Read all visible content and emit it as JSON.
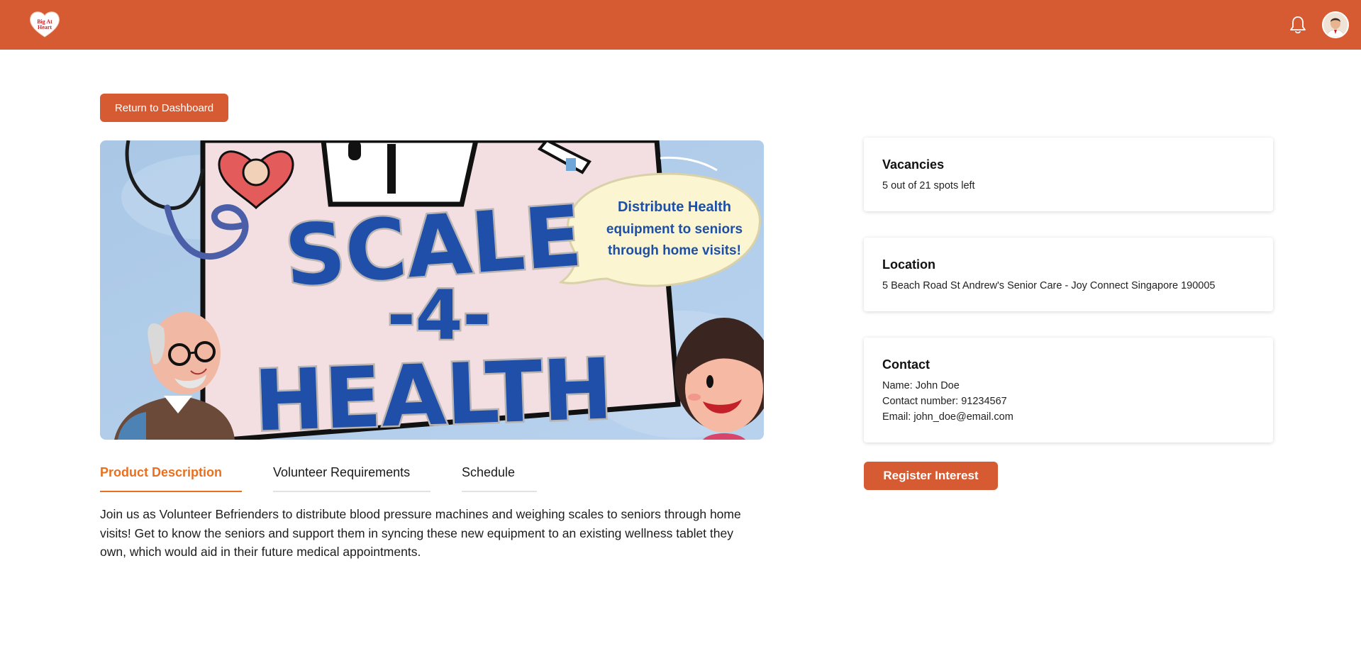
{
  "header": {
    "logo_text": "Big At Heart",
    "brand_color": "#d65b33",
    "icons": [
      "bell-icon",
      "user-avatar"
    ]
  },
  "actions": {
    "return_label": "Return to Dashboard",
    "register_label": "Register Interest"
  },
  "hero": {
    "title_line1": "SCALE",
    "title_line2": "-4-",
    "title_line3": "HEALTH",
    "bubble_line1": "Distribute Health",
    "bubble_line2": "equipment to seniors",
    "bubble_line3": "through home visits!"
  },
  "tabs": [
    {
      "label": "Product Description",
      "active": true
    },
    {
      "label": "Volunteer Requirements",
      "active": false
    },
    {
      "label": "Schedule",
      "active": false
    }
  ],
  "description": "Join us as Volunteer Befrienders to distribute blood pressure machines and weighing scales to seniors through home visits! Get to know the seniors and support them in syncing these new equipment to an existing wellness tablet they own, which would aid in their future medical appointments.",
  "cards": {
    "vacancies": {
      "title": "Vacancies",
      "text": "5 out of 21 spots left"
    },
    "location": {
      "title": "Location",
      "text": "5 Beach Road St Andrew's Senior Care - Joy Connect Singapore 190005"
    },
    "contact": {
      "title": "Contact",
      "name": "Name: John Doe",
      "number": "Contact number: 91234567",
      "email": "Email: john_doe@email.com"
    }
  }
}
